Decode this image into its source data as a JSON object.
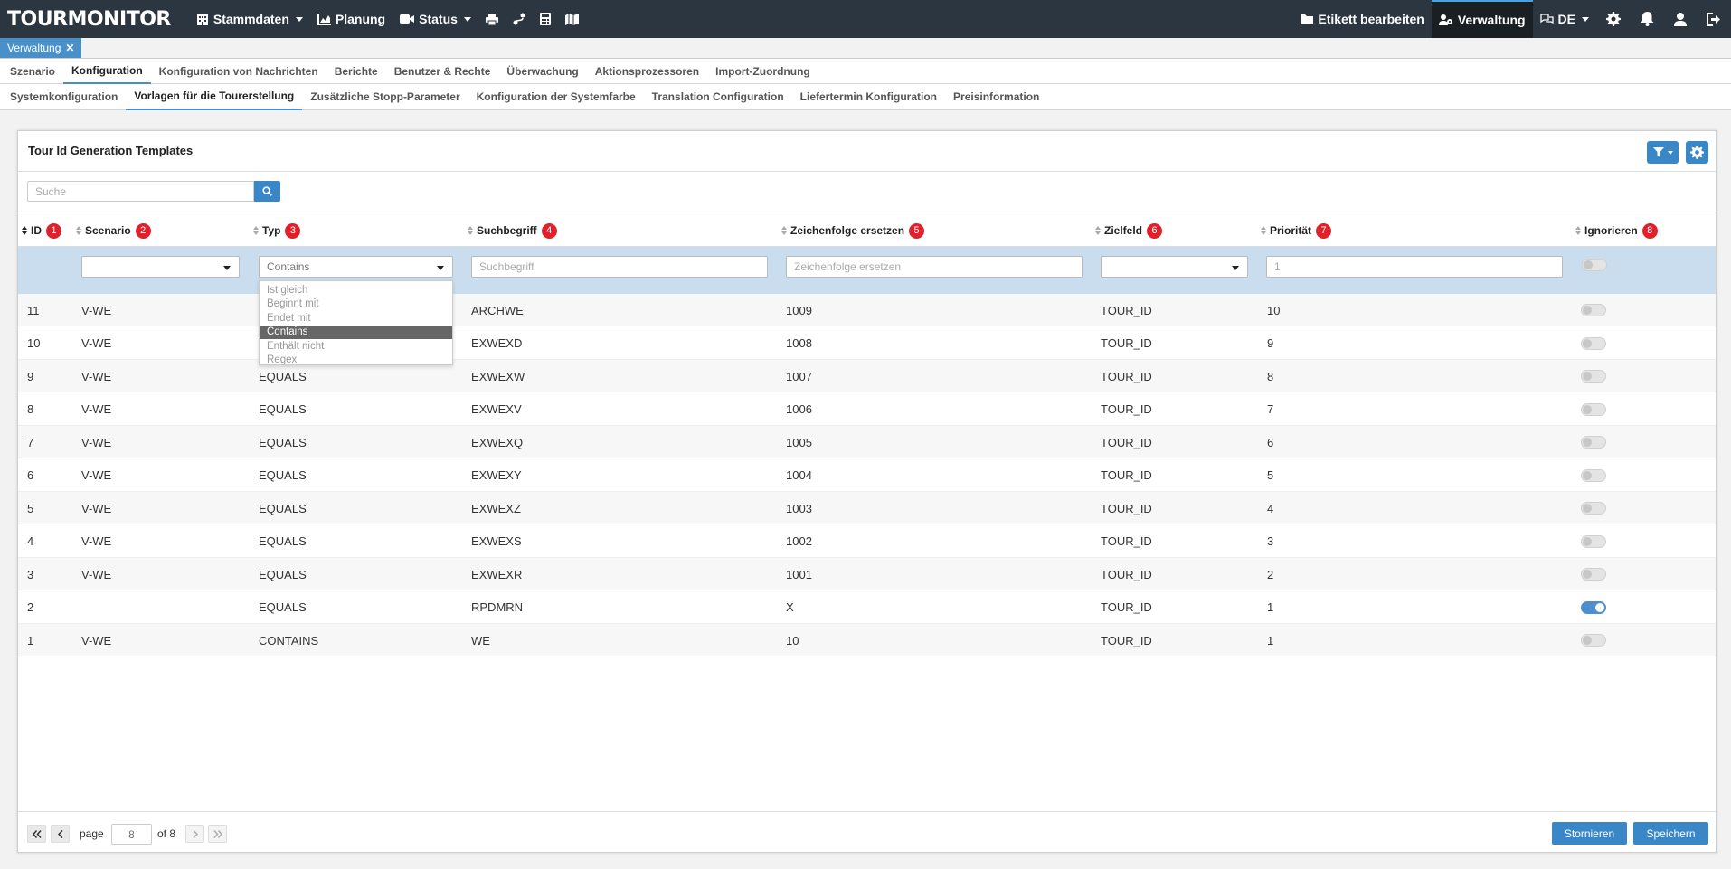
{
  "app": {
    "logo": "TOURMONITOR"
  },
  "topnav": {
    "stammdaten": "Stammdaten",
    "planung": "Planung",
    "status": "Status",
    "etikett": "Etikett bearbeiten",
    "verwaltung": "Verwaltung",
    "language": "DE"
  },
  "doc_tab": {
    "label": "Verwaltung",
    "close": "✕"
  },
  "menu1": [
    "Szenario",
    "Konfiguration",
    "Konfiguration von Nachrichten",
    "Berichte",
    "Benutzer & Rechte",
    "Überwachung",
    "Aktionsprozessoren",
    "Import-Zuordnung"
  ],
  "menu2": [
    "Systemkonfiguration",
    "Vorlagen für die Tourerstellung",
    "Zusätzliche Stopp-Parameter",
    "Konfiguration der Systemfarbe",
    "Translation Configuration",
    "Liefertermin Konfiguration",
    "Preisinformation"
  ],
  "panel": {
    "title": "Tour Id Generation Templates",
    "search_placeholder": "Suche"
  },
  "columns": [
    {
      "label": "ID",
      "badge": "1"
    },
    {
      "label": "Scenario",
      "badge": "2"
    },
    {
      "label": "Typ",
      "badge": "3"
    },
    {
      "label": "Suchbegriff",
      "badge": "4"
    },
    {
      "label": "Zeichenfolge ersetzen",
      "badge": "5"
    },
    {
      "label": "Zielfeld",
      "badge": "6"
    },
    {
      "label": "Priorität",
      "badge": "7"
    },
    {
      "label": "Ignorieren",
      "badge": "8"
    }
  ],
  "filters": {
    "typ_value": "Contains",
    "suchbegriff_placeholder": "Suchbegriff",
    "zeichenfolge_placeholder": "Zeichenfolge ersetzen",
    "prioritaet_placeholder": "1"
  },
  "typ_options": [
    "Ist gleich",
    "Beginnt mit",
    "Endet mit",
    "Contains",
    "Enthält nicht",
    "Regex"
  ],
  "rows": [
    {
      "id": "11",
      "scenario": "V-WE",
      "typ": "",
      "such": "ARCHWE",
      "ersetzen": "1009",
      "ziel": "TOUR_ID",
      "prio": "10",
      "ignore": false
    },
    {
      "id": "10",
      "scenario": "V-WE",
      "typ": "",
      "such": "EXWEXD",
      "ersetzen": "1008",
      "ziel": "TOUR_ID",
      "prio": "9",
      "ignore": false
    },
    {
      "id": "9",
      "scenario": "V-WE",
      "typ": "EQUALS",
      "such": "EXWEXW",
      "ersetzen": "1007",
      "ziel": "TOUR_ID",
      "prio": "8",
      "ignore": false
    },
    {
      "id": "8",
      "scenario": "V-WE",
      "typ": "EQUALS",
      "such": "EXWEXV",
      "ersetzen": "1006",
      "ziel": "TOUR_ID",
      "prio": "7",
      "ignore": false
    },
    {
      "id": "7",
      "scenario": "V-WE",
      "typ": "EQUALS",
      "such": "EXWEXQ",
      "ersetzen": "1005",
      "ziel": "TOUR_ID",
      "prio": "6",
      "ignore": false
    },
    {
      "id": "6",
      "scenario": "V-WE",
      "typ": "EQUALS",
      "such": "EXWEXY",
      "ersetzen": "1004",
      "ziel": "TOUR_ID",
      "prio": "5",
      "ignore": false
    },
    {
      "id": "5",
      "scenario": "V-WE",
      "typ": "EQUALS",
      "such": "EXWEXZ",
      "ersetzen": "1003",
      "ziel": "TOUR_ID",
      "prio": "4",
      "ignore": false
    },
    {
      "id": "4",
      "scenario": "V-WE",
      "typ": "EQUALS",
      "such": "EXWEXS",
      "ersetzen": "1002",
      "ziel": "TOUR_ID",
      "prio": "3",
      "ignore": false
    },
    {
      "id": "3",
      "scenario": "V-WE",
      "typ": "EQUALS",
      "such": "EXWEXR",
      "ersetzen": "1001",
      "ziel": "TOUR_ID",
      "prio": "2",
      "ignore": false
    },
    {
      "id": "2",
      "scenario": "",
      "typ": "EQUALS",
      "such": "RPDMRN",
      "ersetzen": "X",
      "ziel": "TOUR_ID",
      "prio": "1",
      "ignore": true
    },
    {
      "id": "1",
      "scenario": "V-WE",
      "typ": "CONTAINS",
      "such": "WE",
      "ersetzen": "10",
      "ziel": "TOUR_ID",
      "prio": "1",
      "ignore": false
    }
  ],
  "pagination": {
    "page_label": "page",
    "page_value": "8",
    "of_label": "of 8"
  },
  "buttons": {
    "cancel": "Stornieren",
    "save": "Speichern"
  },
  "colors": {
    "navbar": "#2b3640",
    "accent": "#3a87c8",
    "filter_row": "#c9ddef",
    "badge": "#e0202a"
  }
}
